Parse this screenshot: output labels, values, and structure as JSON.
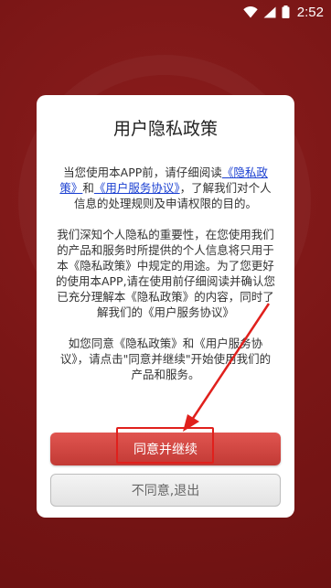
{
  "status_bar": {
    "time": "2:52",
    "icons": [
      "wifi-icon",
      "signal-icon",
      "battery-icon"
    ]
  },
  "dialog": {
    "title": "用户隐私政策",
    "para1": {
      "t1": "当您使用本APP前，请仔细阅读",
      "link1": "《隐私政策》",
      "t2": "和",
      "link2": "《用户服务协议》",
      "t3": "，了解我们对个人信息的处理规则及申请权限的目的。"
    },
    "para2": "我们深知个人隐私的重要性，在您使用我们的产品和服务时所提供的个人信息将只用于本《隐私政策》中规定的用途。为了您更好的使用本APP,请在使用前仔细阅读并确认您已充分理解本《隐私政策》的内容，同时了解我们的《用户服务协议》",
    "para3": "如您同意《隐私政策》和《用户服务协议》，请点击\"同意并继续\"开始使用我们的产品和服务。",
    "agree_label": "同意并继续",
    "disagree_label": "不同意,退出"
  },
  "colors": {
    "background": "#7a1616",
    "accent": "#d0443f",
    "link": "#1a3fd1",
    "annotation": "#e0201c"
  }
}
